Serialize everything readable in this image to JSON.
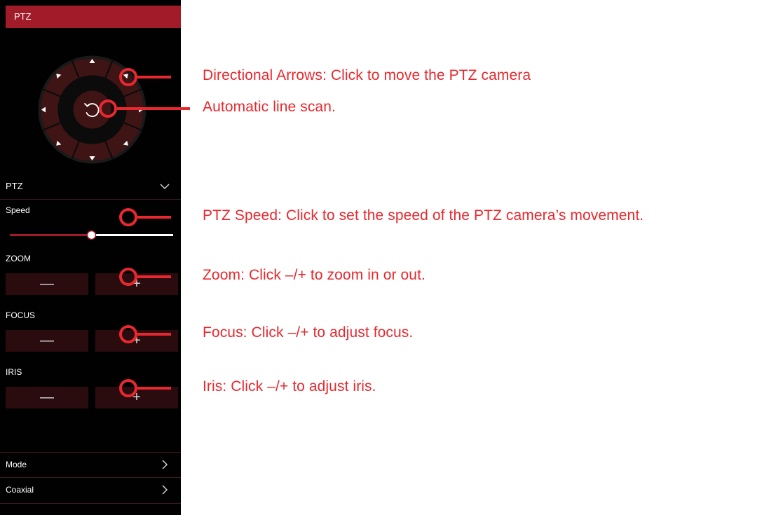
{
  "colors": {
    "panel_bg": "#010101",
    "header_red": "#a11b28",
    "button_bg": "#2a0c0e",
    "annotation_red": "#e8282e"
  },
  "panel": {
    "title": "PTZ",
    "joystick": {
      "center_icon": "rotate-ccw-icon",
      "arrows": [
        "up",
        "up-right",
        "right",
        "down-right",
        "down",
        "down-left",
        "left",
        "up-left"
      ]
    },
    "ptz_dropdown": {
      "label": "PTZ",
      "icon": "chevron-down-icon"
    },
    "speed": {
      "label": "Speed",
      "level": 0.5
    },
    "zoom": {
      "label": "ZOOM",
      "minus": "—",
      "plus": "+"
    },
    "focus": {
      "label": "FOCUS",
      "minus": "—",
      "plus": "+"
    },
    "iris": {
      "label": "IRIS",
      "minus": "—",
      "plus": "+"
    },
    "mode": {
      "label": "Mode",
      "icon": "chevron-right-icon"
    },
    "coaxial": {
      "label": "Coaxial",
      "icon": "chevron-right-icon"
    }
  },
  "annotations": {
    "directional": "Directional Arrows: Click to move the PTZ camera",
    "scan": "Automatic line scan.",
    "speed": "PTZ Speed: Click to set the speed of the PTZ camera’s movement.",
    "zoom": "Zoom: Click –/+ to zoom in or out.",
    "focus": "Focus: Click –/+ to adjust focus.",
    "iris": "Iris: Click –/+ to adjust iris."
  }
}
